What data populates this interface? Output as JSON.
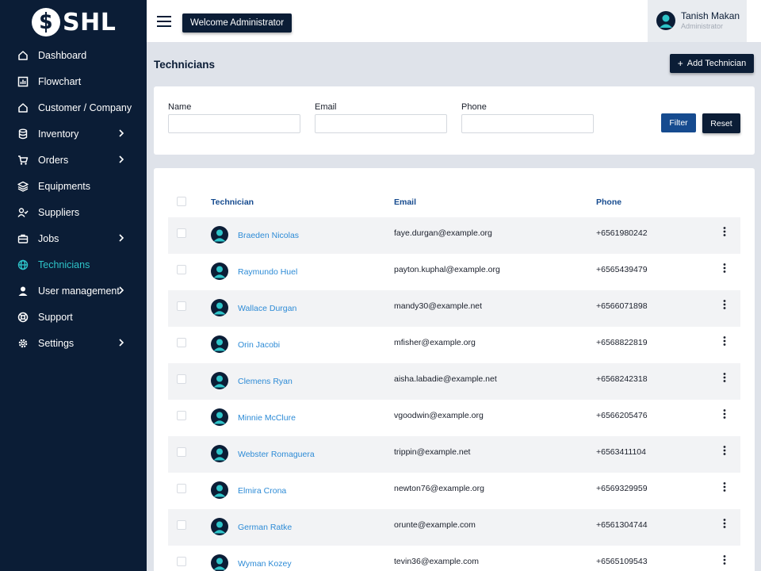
{
  "brand": {
    "logo_text": "SHL",
    "logo_icon": "dollar-circle-icon"
  },
  "sidebar": {
    "items": [
      {
        "label": "Dashboard",
        "icon": "home-icon",
        "has_submenu": false,
        "active": false
      },
      {
        "label": "Flowchart",
        "icon": "chart-icon",
        "has_submenu": false,
        "active": false
      },
      {
        "label": "Customer / Company",
        "icon": "home-icon",
        "has_submenu": false,
        "active": false
      },
      {
        "label": "Inventory",
        "icon": "database-icon",
        "has_submenu": true,
        "active": false
      },
      {
        "label": "Orders",
        "icon": "cart-icon",
        "has_submenu": true,
        "active": false
      },
      {
        "label": "Equipments",
        "icon": "layers-icon",
        "has_submenu": false,
        "active": false
      },
      {
        "label": "Suppliers",
        "icon": "user-check-icon",
        "has_submenu": false,
        "active": false
      },
      {
        "label": "Jobs",
        "icon": "briefcase-icon",
        "has_submenu": true,
        "active": false
      },
      {
        "label": "Technicians",
        "icon": "globe-icon",
        "has_submenu": false,
        "active": true
      },
      {
        "label": "User management",
        "icon": "user-icon",
        "has_submenu": true,
        "active": false
      },
      {
        "label": "Support",
        "icon": "lifebuoy-icon",
        "has_submenu": false,
        "active": false
      },
      {
        "label": "Settings",
        "icon": "gear-icon",
        "has_submenu": true,
        "active": false
      }
    ]
  },
  "topbar": {
    "welcome_label": "Welcome Administrator",
    "user": {
      "name": "Tanish Makan",
      "role": "Administrator"
    }
  },
  "page": {
    "title": "Technicians",
    "add_button_label": "Add Technician"
  },
  "filters": {
    "name_label": "Name",
    "name_value": "",
    "email_label": "Email",
    "email_value": "",
    "phone_label": "Phone",
    "phone_value": "",
    "filter_label": "Filter",
    "reset_label": "Reset"
  },
  "table": {
    "columns": [
      "Technician",
      "Email",
      "Phone"
    ],
    "rows": [
      {
        "name": "Braeden Nicolas",
        "email": "faye.durgan@example.org",
        "phone": "+6561980242"
      },
      {
        "name": "Raymundo Huel",
        "email": "payton.kuphal@example.org",
        "phone": "+6565439479"
      },
      {
        "name": "Wallace Durgan",
        "email": "mandy30@example.net",
        "phone": "+6566071898"
      },
      {
        "name": "Orin Jacobi",
        "email": "mfisher@example.org",
        "phone": "+6568822819"
      },
      {
        "name": "Clemens Ryan",
        "email": "aisha.labadie@example.net",
        "phone": "+6568242318"
      },
      {
        "name": "Minnie McClure",
        "email": "vgoodwin@example.org",
        "phone": "+6566205476"
      },
      {
        "name": "Webster Romaguera",
        "email": "trippin@example.net",
        "phone": "+6563411104"
      },
      {
        "name": "Elmira Crona",
        "email": "newton76@example.org",
        "phone": "+6569329959"
      },
      {
        "name": "German Ratke",
        "email": "orunte@example.com",
        "phone": "+6561304744"
      },
      {
        "name": "Wyman Kozey",
        "email": "tevin36@example.com",
        "phone": "+6565109543"
      }
    ]
  },
  "colors": {
    "sidebar_bg": "#0b1d36",
    "active_accent": "#2ec4c9",
    "link_blue": "#2d8bd6",
    "header_blue": "#164b8f",
    "page_bg": "#dfe3ea"
  }
}
